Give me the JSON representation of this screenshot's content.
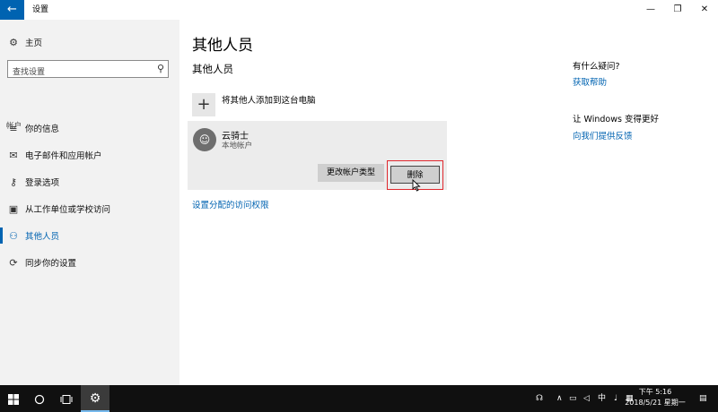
{
  "window": {
    "title": "设置",
    "back_icon": "←",
    "minimize": "—",
    "maximize": "❐",
    "close": "✕"
  },
  "sidebar": {
    "home_label": "主页",
    "search_placeholder": "查找设置",
    "section_label": "帐户",
    "items": [
      {
        "label": "你的信息",
        "icon": "user-card-icon",
        "glyph": "≡"
      },
      {
        "label": "电子邮件和应用帐户",
        "icon": "mail-icon",
        "glyph": "✉"
      },
      {
        "label": "登录选项",
        "icon": "key-icon",
        "glyph": "⚷"
      },
      {
        "label": "从工作单位或学校访问",
        "icon": "briefcase-icon",
        "glyph": "▣"
      },
      {
        "label": "其他人员",
        "icon": "people-icon",
        "glyph": "⚇",
        "active": true
      },
      {
        "label": "同步你的设置",
        "icon": "sync-icon",
        "glyph": "⟳"
      }
    ]
  },
  "main": {
    "page_title": "其他人员",
    "section_title": "其他人员",
    "add_label": "将其他人添加到这台电脑",
    "user": {
      "name": "云骑士",
      "type": "本地帐户",
      "change_button": "更改帐户类型",
      "delete_button": "删除"
    },
    "assign_link": "设置分配的访问权限"
  },
  "aside": {
    "question_title": "有什么疑问?",
    "help_link": "获取帮助",
    "improve_title": "让 Windows 变得更好",
    "feedback_link": "向我们提供反馈"
  },
  "taskbar": {
    "ime": "中",
    "time": "下午 5:16",
    "date": "2018/5/21 星期一"
  },
  "colors": {
    "accent": "#0063b1",
    "highlight_border": "#e0282e",
    "taskbar": "#101010"
  }
}
